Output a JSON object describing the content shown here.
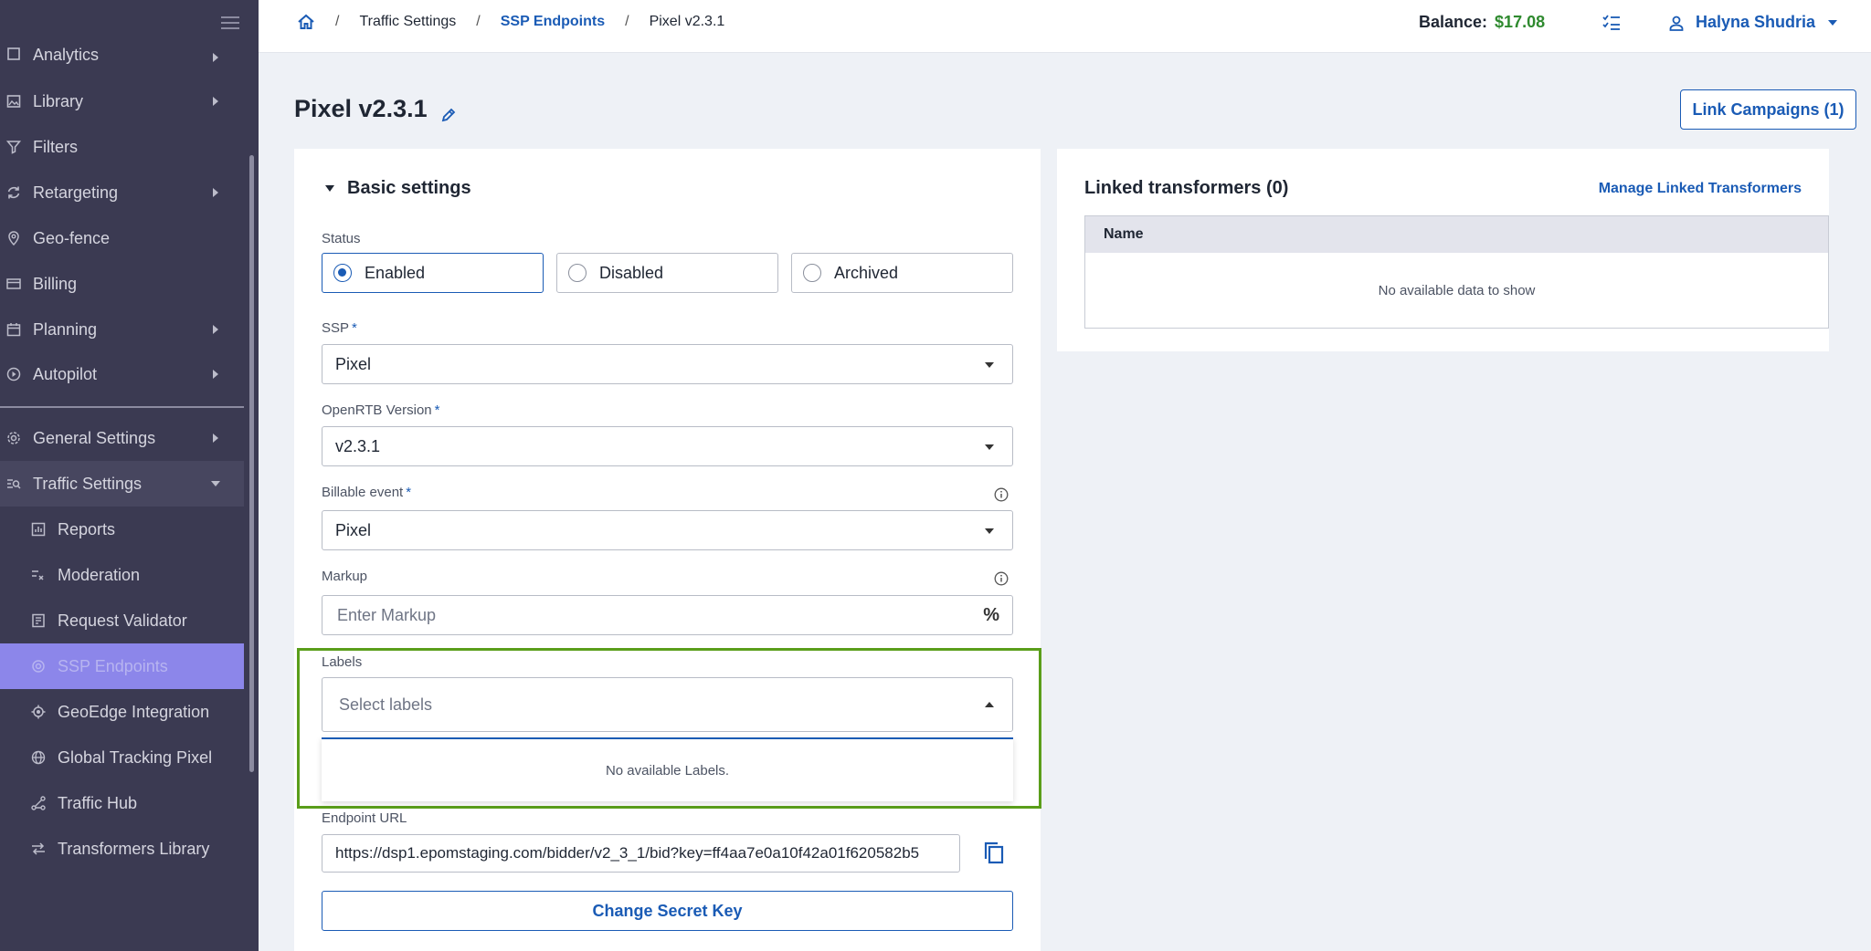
{
  "sidebar": {
    "items": [
      {
        "label": "Analytics"
      },
      {
        "label": "Library"
      },
      {
        "label": "Filters"
      },
      {
        "label": "Retargeting"
      },
      {
        "label": "Geo-fence"
      },
      {
        "label": "Billing"
      },
      {
        "label": "Planning"
      },
      {
        "label": "Autopilot"
      },
      {
        "label": "General Settings"
      },
      {
        "label": "Traffic Settings"
      }
    ],
    "sub_items": [
      {
        "label": "Reports"
      },
      {
        "label": "Moderation"
      },
      {
        "label": "Request Validator"
      },
      {
        "label": "SSP Endpoints"
      },
      {
        "label": "GeoEdge Integration"
      },
      {
        "label": "Global Tracking Pixel"
      },
      {
        "label": "Traffic Hub"
      },
      {
        "label": "Transformers Library"
      }
    ]
  },
  "topbar": {
    "breadcrumb": [
      "Traffic Settings",
      "SSP Endpoints",
      "Pixel v2.3.1"
    ],
    "balance_label": "Balance:",
    "balance_value": "$17.08",
    "user_name": "Halyna Shudria"
  },
  "page": {
    "title": "Pixel v2.3.1",
    "link_campaigns": "Link Campaigns (1)"
  },
  "basic": {
    "title": "Basic settings",
    "status_label": "Status",
    "status_options": [
      "Enabled",
      "Disabled",
      "Archived"
    ],
    "ssp_label": "SSP",
    "ssp_value": "Pixel",
    "openrtb_label": "OpenRTB Version",
    "openrtb_value": "v2.3.1",
    "billable_label": "Billable event",
    "billable_value": "Pixel",
    "markup_label": "Markup",
    "markup_placeholder": "Enter Markup",
    "markup_icon": "%",
    "labels_label": "Labels",
    "labels_placeholder": "Select labels",
    "labels_empty": "No available Labels.",
    "endpoint_label": "Endpoint URL",
    "endpoint_value": "https://dsp1.epomstaging.com/bidder/v2_3_1/bid?key=ff4aa7e0a10f42a01f620582b5",
    "secret_button": "Change Secret Key",
    "required_mark": "*"
  },
  "linked": {
    "title": "Linked transformers (0)",
    "manage": "Manage Linked Transformers",
    "column": "Name",
    "empty": "No available data to show"
  },
  "colors": {
    "accent": "#1a5bb5",
    "sidebar_bg": "#3b3a52",
    "selected_item": "#8c86ea",
    "highlight": "#5a9e1a",
    "balance": "#2f8a2f"
  }
}
